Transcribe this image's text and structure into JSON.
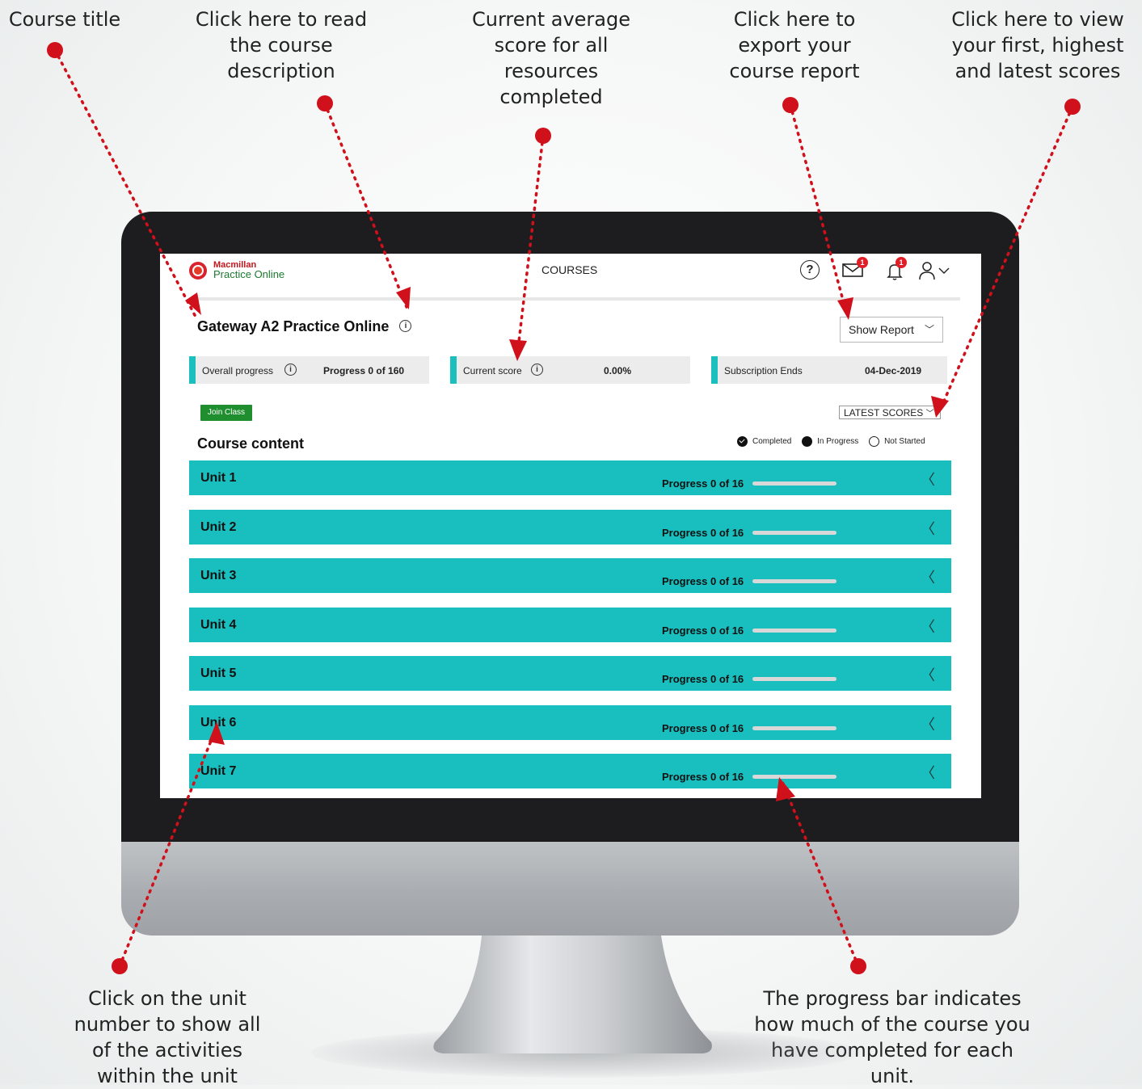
{
  "callouts": {
    "course_title": "Course title",
    "description": "Click here to read the course description",
    "current_score": "Current average score for all resources completed",
    "export": "Click here to export your course report",
    "scores": "Click here to view your first, highest and latest scores",
    "unit_number": "Click on the unit number to show all of the activities within the unit",
    "progress_bar": "The progress bar indicates how much of the course you have completed for each unit."
  },
  "header": {
    "logo_line1": "Macmillan",
    "logo_line2": "Practice Online",
    "nav_courses": "COURSES",
    "help_icon": "help-circle-icon",
    "mail_badge": "1",
    "bell_badge": "1"
  },
  "course": {
    "title": "Gateway A2 Practice Online",
    "show_report_label": "Show Report"
  },
  "stats": {
    "overall_label": "Overall progress",
    "overall_value": "Progress 0 of 160",
    "score_label": "Current score",
    "score_value": "0.00%",
    "subscription_label": "Subscription Ends",
    "subscription_value": "04-Dec-2019"
  },
  "actions": {
    "join_class": "Join Class",
    "latest_scores": "LATEST SCORES"
  },
  "content": {
    "heading": "Course content",
    "legend": {
      "completed": "Completed",
      "in_progress": "In Progress",
      "not_started": "Not Started"
    }
  },
  "units": [
    {
      "label": "Unit 1",
      "progress": "Progress 0 of 16",
      "fraction": 0
    },
    {
      "label": "Unit 2",
      "progress": "Progress 0 of 16",
      "fraction": 0
    },
    {
      "label": "Unit 3",
      "progress": "Progress 0 of 16",
      "fraction": 0
    },
    {
      "label": "Unit 4",
      "progress": "Progress 0 of 16",
      "fraction": 0
    },
    {
      "label": "Unit 5",
      "progress": "Progress 0 of 16",
      "fraction": 0
    },
    {
      "label": "Unit 6",
      "progress": "Progress 0 of 16",
      "fraction": 0
    },
    {
      "label": "Unit 7",
      "progress": "Progress 0 of 16",
      "fraction": 0
    }
  ],
  "colors": {
    "teal": "#19bfbe",
    "green": "#1e8e2e",
    "annotation_red": "#d0101b",
    "bezel": "#1d1d1f"
  }
}
